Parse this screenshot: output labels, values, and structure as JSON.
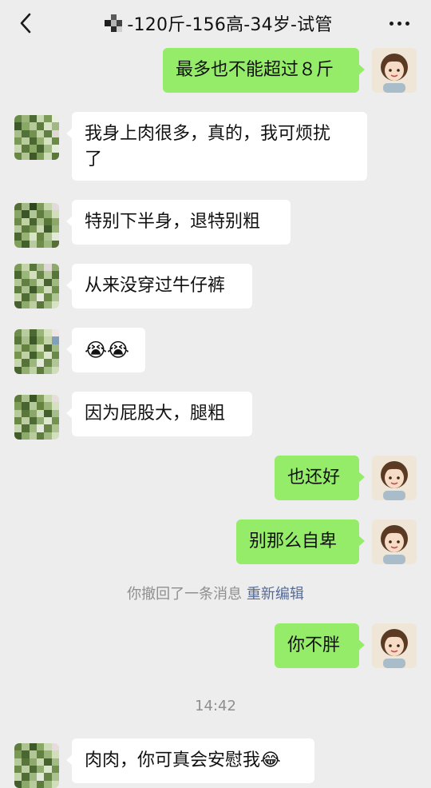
{
  "header": {
    "title": "-120斤-156高-34岁-试管",
    "back_icon": "chevron-left-icon",
    "more_icon": "more-dots-icon"
  },
  "messages": [
    {
      "side": "right",
      "text": "最多也不能超过８斤"
    },
    {
      "side": "left",
      "text": "我身上肉很多，真的，我可烦扰\n了"
    },
    {
      "side": "left",
      "text": "特别下半身，退特别粗"
    },
    {
      "side": "left",
      "text": "从来没穿过牛仔裤"
    },
    {
      "side": "left",
      "text": "😭😭"
    },
    {
      "side": "left",
      "text": "因为屁股大，腿粗"
    },
    {
      "side": "right",
      "text": "也还好"
    },
    {
      "side": "right",
      "text": "别那么自卑"
    },
    {
      "side": "right",
      "text": "你不胖"
    },
    {
      "side": "left",
      "text": "肉肉，你可真会安慰我😂"
    }
  ],
  "system": {
    "recall_text": "你撤回了一条消息",
    "reedit_label": "重新编辑",
    "timestamp": "14:42"
  },
  "colors": {
    "background": "#ededed",
    "bubble_self": "#95ec69",
    "bubble_other": "#ffffff",
    "link": "#576b95"
  }
}
